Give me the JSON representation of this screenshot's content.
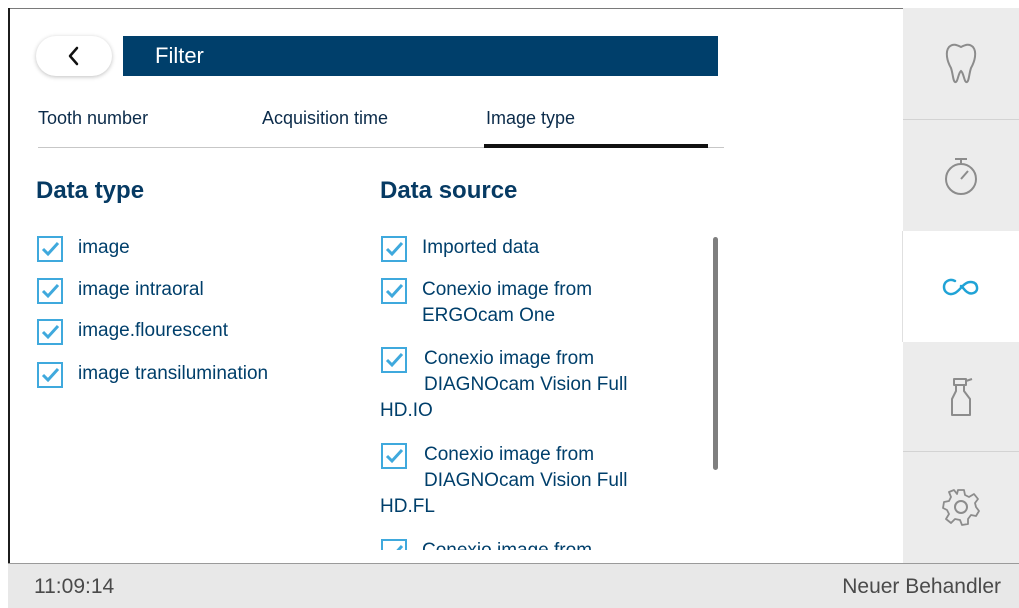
{
  "header": {
    "back_icon": "chevron-left-icon",
    "title": "Filter"
  },
  "tabs": [
    {
      "label": "Tooth number"
    },
    {
      "label": "Acquisition time"
    },
    {
      "label": "Image type",
      "active": true
    }
  ],
  "data_type": {
    "title": "Data type",
    "items": [
      {
        "label": "image",
        "checked": true
      },
      {
        "label": "image intraoral",
        "checked": true
      },
      {
        "label": "image.flourescent",
        "checked": true
      },
      {
        "label": "image transilumination",
        "checked": true
      }
    ]
  },
  "data_source": {
    "title": "Data source",
    "items": [
      {
        "lines": [
          "Imported data"
        ],
        "checked": true
      },
      {
        "lines": [
          "Conexio image from",
          "ERGOcam One"
        ],
        "checked": true
      },
      {
        "lines": [
          "Conexio image from",
          "DIAGNOcam Vision Full",
          "HD.IO"
        ],
        "checked": true
      },
      {
        "lines": [
          "Conexio image from",
          "DIAGNOcam Vision Full",
          "HD.FL"
        ],
        "checked": true
      },
      {
        "lines": [
          "Conexio image from"
        ],
        "checked": true
      }
    ]
  },
  "sidebar": {
    "items": [
      {
        "icon": "tooth-icon"
      },
      {
        "icon": "stopwatch-icon"
      },
      {
        "icon": "conexio-icon",
        "active": true
      },
      {
        "icon": "spray-bottle-icon"
      },
      {
        "icon": "gear-icon"
      }
    ]
  },
  "status_bar": {
    "time": "11:09:14",
    "user": "Neuer Behandler"
  },
  "colors": {
    "primary": "#003f6b",
    "accent": "#20a3d6",
    "checkbox": "#3fa9dd",
    "panel": "#ececec"
  }
}
